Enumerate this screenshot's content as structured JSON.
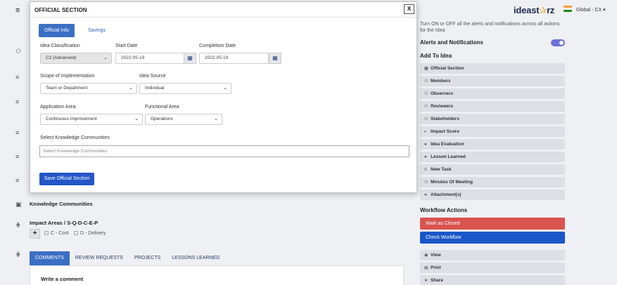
{
  "header": {
    "logo_text_a": "ideast",
    "logo_star": "✰",
    "logo_text_b": "rz",
    "region": "Global - CX ▾",
    "flag_colors": [
      "#ff9933",
      "#ffffff",
      "#138808"
    ]
  },
  "right_panel": {
    "alerts_desc": "Turn ON or OFF all the alerts and notifications across all actions for the Idea",
    "alerts_title": "Alerts and Notifications",
    "alerts_enabled": true,
    "add_to_idea_title": "Add To Idea",
    "items": [
      {
        "label": "Official Section",
        "icon": "building-icon"
      },
      {
        "label": "Members",
        "icon": "users-icon"
      },
      {
        "label": "Observers",
        "icon": "users-icon"
      },
      {
        "label": "Reviewers",
        "icon": "users-icon"
      },
      {
        "label": "Stakeholders",
        "icon": "users-icon"
      },
      {
        "label": "Impact Score",
        "icon": "half-circle-icon"
      },
      {
        "label": "Idea Evaluation",
        "icon": "map-pin-icon"
      },
      {
        "label": "Lesson Learned",
        "icon": "map-pin-icon"
      },
      {
        "label": "New Task",
        "icon": "list-icon"
      },
      {
        "label": "Minutes Of Meeting",
        "icon": "group-icon"
      },
      {
        "label": "Attachment(s)",
        "icon": "paperclip-icon"
      }
    ],
    "workflow_title": "Workflow Actions",
    "mark_closed": "Mark as Closed",
    "check_workflow": "Check Workflow",
    "extra_items": [
      {
        "label": "View",
        "icon": "eye-icon"
      },
      {
        "label": "Print",
        "icon": "print-icon"
      },
      {
        "label": "Share",
        "icon": "share-icon"
      }
    ],
    "colors": {
      "mark_closed": "#d9534f",
      "check_workflow": "#1a57c9",
      "toggle": "#6a6fd9"
    }
  },
  "background": {
    "knowledge_communities": "Knowledge Communities",
    "impact_areas": "Impact Areas / S-Q-D-C-E-P",
    "plus": "+",
    "cost": "C - Cost",
    "delivery": "D - Delivery",
    "tabs": [
      "COMMENTS",
      "REVIEW REQUESTS",
      "PROJECTS",
      "LESSONS LEARNED"
    ],
    "write_comment": "Write a comment"
  },
  "modal": {
    "title": "OFFICIAL SECTION",
    "close": "X",
    "tab_official": "Official Info",
    "tab_savings": "Savings",
    "idea_classification_label": "Idea Classification",
    "idea_classification_value": "C2 (Advanced)",
    "start_date_label": "Start Date",
    "start_date_value": "2022-05-19",
    "completion_date_label": "Completion Date",
    "completion_date_value": "2022-05-19",
    "scope_label": "Scope of Implementation",
    "scope_value": "Team or Department",
    "source_label": "Idea Source",
    "source_value": "Individual",
    "app_area_label": "Application Area",
    "app_area_value": "Continuous Improvement",
    "func_area_label": "Functional Area",
    "func_area_value": "Operations",
    "kc_label": "Select Knowledge Communities",
    "kc_placeholder": "Select Knowledge Communities",
    "save_label": "Save Official Section"
  }
}
